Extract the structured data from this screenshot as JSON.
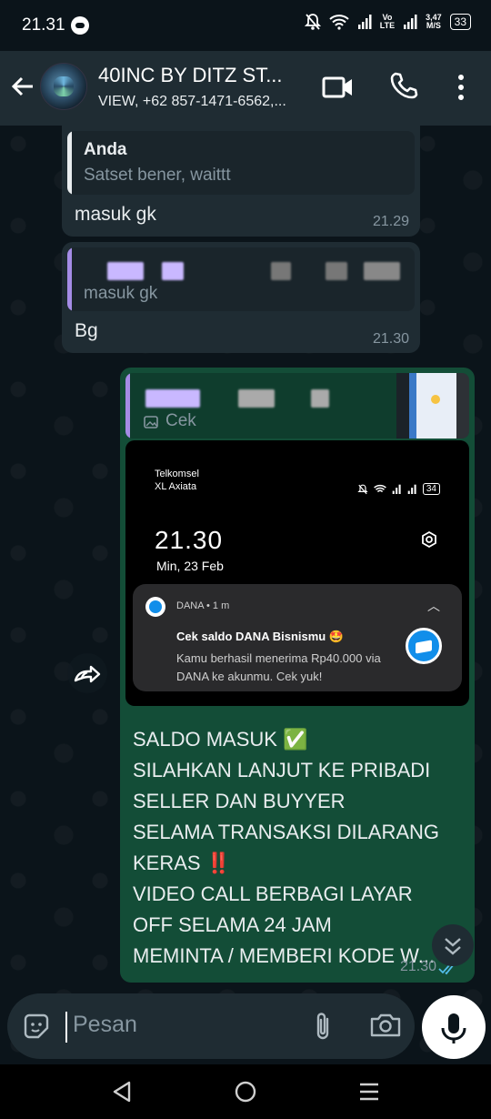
{
  "status_bar": {
    "time": "21.31",
    "speed_value": "3,47",
    "speed_unit": "M/S",
    "battery": "33",
    "network_label": "Vo LTE"
  },
  "header": {
    "title": "40INC BY DITZ ST...",
    "subtitle": "VIEW, +62 857-1471-6562,..."
  },
  "messages": [
    {
      "direction": "incoming",
      "quote_author": "Anda",
      "quote_text": "Satset bener, waittt",
      "text": "masuk gk",
      "time": "21.29"
    },
    {
      "direction": "incoming",
      "quote_text": "masuk gk",
      "text": "Bg",
      "time": "21.30"
    },
    {
      "direction": "outgoing",
      "quote_text": "Cek",
      "time": "21.30",
      "screenshot": {
        "carrier1": "Telkomsel",
        "carrier2": "XL Axiata",
        "battery": "34",
        "clock": "21.30",
        "date": "Min, 23 Feb",
        "notification": {
          "app": "DANA • 1 m",
          "title": "Cek saldo DANA Bisnismu 🤩",
          "body": "Kamu berhasil menerima Rp40.000 via DANA ke akunmu. Cek yuk!"
        }
      },
      "text": "SALDO MASUK ✅\nSILAHKAN LANJUT KE PRIBADI\nSELLER DAN BUYYER\nSELAMA TRANSAKSI DILARANG\nKERAS ‼️\nVIDEO CALL BERBAGI LAYAR\nOFF SELAMA 24 JAM\nMEMINTA / MEMBERI KODE W..."
    }
  ],
  "composer": {
    "placeholder": "Pesan"
  },
  "colors": {
    "incoming_bubble": "#1f2c33",
    "outgoing_bubble": "#134d37",
    "quote_bar_self": "#e9edef",
    "quote_bar_other": "#a58ce6",
    "accent_blue": "#53bdeb"
  },
  "icons": [
    "back-arrow-icon",
    "video-call-icon",
    "voice-call-icon",
    "more-options-icon",
    "forward-icon",
    "scroll-down-icon",
    "sticker-icon",
    "attach-icon",
    "camera-icon",
    "mic-icon",
    "nav-back-icon",
    "nav-home-icon",
    "nav-recents-icon"
  ]
}
